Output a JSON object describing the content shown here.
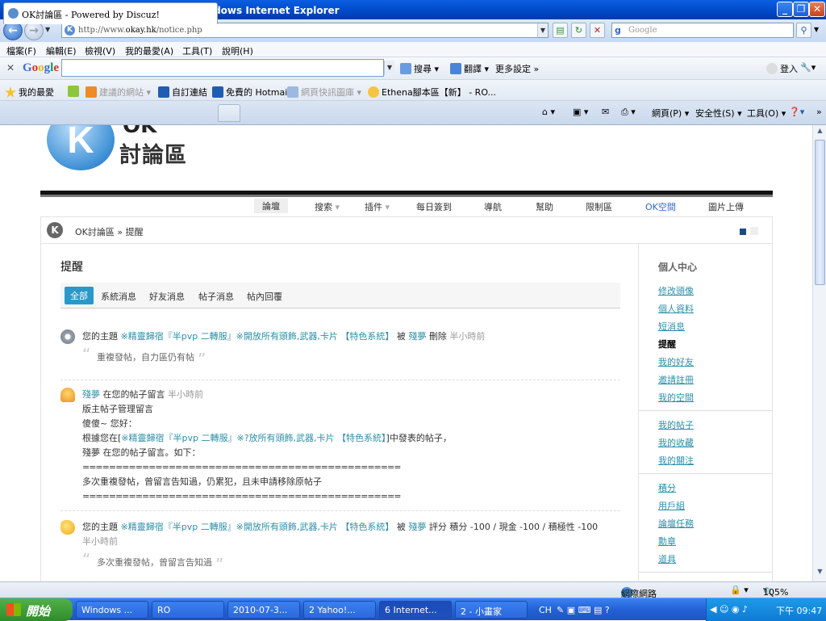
{
  "window": {
    "title": "OK討論區 - Powered by Discuz! - Windows Internet Explorer"
  },
  "address": {
    "url_prefix": "http://www.",
    "url_domain": "okay.hk",
    "url_path": "/notice.php",
    "search_placeholder": "Google"
  },
  "menu": [
    "檔案(F)",
    "編輯(E)",
    "檢視(V)",
    "我的最愛(A)",
    "工具(T)",
    "說明(H)"
  ],
  "google_bar": {
    "logo": "Google",
    "search_label": "搜尋",
    "translate_label": "翻譯",
    "more_settings": "更多設定 »",
    "login": "登入"
  },
  "favorites_bar": {
    "favorites": "我的最愛",
    "suggested": "建議的網站",
    "custom_links": "自訂連結",
    "hotmail": "免費的 Hotmail",
    "web_slice": "網頁快訊圖庫",
    "ethena": "Ethena腳本區【新】 - RO..."
  },
  "tab": {
    "title": "OK討論區 - Powered by Discuz!"
  },
  "commands": {
    "page": "網頁(P)",
    "safety": "安全性(S)",
    "tools": "工具(O)"
  },
  "site": {
    "logo_letter": "K",
    "logo_top": "OK",
    "logo_text": "討論區",
    "nav": [
      "論壇",
      "搜索",
      "插件",
      "每日簽到",
      "導航",
      "幫助",
      "限制區",
      "OK空間",
      "圖片上傳"
    ],
    "breadcrumb": {
      "home": "OK討論區",
      "sep": "»",
      "current": "提醒"
    }
  },
  "main": {
    "heading": "提醒",
    "tabs": [
      "全部",
      "系統消息",
      "好友消息",
      "帖子消息",
      "帖內回覆"
    ],
    "notices": [
      {
        "prefix": "您的主題",
        "thread": "※精靈歸宿『半pvp 二轉服』※開放所有頭飾,武器,卡片 【特色系統】",
        "by": "被",
        "user": "殘夢",
        "action": "刪除",
        "time": "半小時前",
        "quote": "重複發帖，自力區仍有帖"
      },
      {
        "line1_user": "殘夢",
        "line1_text": "在您的帖子留言",
        "line1_time": "半小時前",
        "line2": "版主帖子管理留言",
        "line3": "傻傻~ 您好：",
        "line4_pre": "根據您在[",
        "line4_link": "※精靈歸宿『半pvp 二轉服』※?放所有頭飾,武器,卡片 【特色系統】",
        "line4_post": "]中發表的帖子，",
        "line5": "殘夢 在您的帖子留言。如下：",
        "divider": "================================================",
        "line6": "多次重複發帖，曾留言告知過，仍累犯，且未申請移除原帖子",
        "divider2": "================================================"
      },
      {
        "prefix": "您的主題",
        "thread": "※精靈歸宿『半pvp 二轉服』※開放所有頭飾,武器,卡片 【特色系統】",
        "by": "被",
        "user": "殘夢",
        "action": "評分 積分 -100 / 現金 -100 / 積極性 -100",
        "time": "半小時前",
        "quote": "多次重複發帖，曾留言告知過"
      }
    ]
  },
  "sidebar": {
    "heading": "個人中心",
    "group1": [
      "修改頭像",
      "個人資料",
      "短消息",
      "提醒",
      "我的好友",
      "邀請註冊",
      "我的空間"
    ],
    "group2": [
      "我的帖子",
      "我的收藏",
      "我的關注"
    ],
    "group3": [
      "積分",
      "用戶組",
      "論壇任務",
      "勳章",
      "道具"
    ]
  },
  "status": {
    "zone": "網際網路",
    "zoom": "105%"
  },
  "taskbar": {
    "start": "開始",
    "buttons": [
      "Windows ...",
      "RO",
      "2010-07-3...",
      "2 Yahoo!...",
      "6 Internet...",
      "2 - 小畫家"
    ],
    "lang": "CH",
    "clock": "下午 09:47"
  }
}
